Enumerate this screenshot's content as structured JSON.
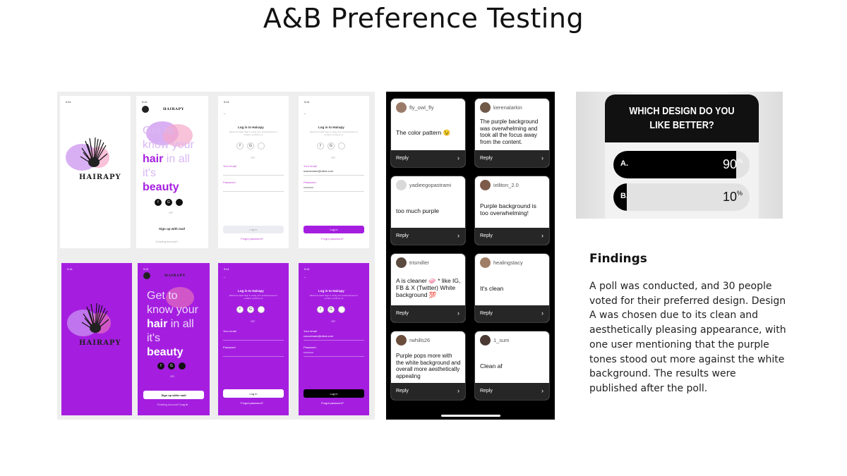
{
  "title": "A&B Preference Testing",
  "mockups": {
    "status_time": "9:41",
    "brand": "HAIRAPY",
    "tagline_parts": [
      "Get to",
      "know your",
      "hair",
      "in all",
      "it's",
      "beauty"
    ],
    "signup_label": "Sign up with mail",
    "signup_label_purple": "Sign up withe mail",
    "existing_account": "Existing account?",
    "login_link": "Log In",
    "login_title": "Log in to Hairapy",
    "login_subtitle": "Welcome back! Sign in using your social account or email to continue us",
    "or_label": "OR",
    "email_label": "Your email",
    "email_value": "nazozimam@uthut.com",
    "password_label": "Password",
    "password_value": "••••••••••",
    "login_button": "Log in",
    "forgot_password": "Forgot password?"
  },
  "replies": [
    {
      "user": "fly_owl_fly",
      "text": "The color pattern 😉",
      "reply": "Reply",
      "avatar": "#9a7b6a"
    },
    {
      "user": "kerenalarkin",
      "text": "The purple background was overwhelming and took all the focus away from the content.",
      "reply": "Reply",
      "avatar": "#6f5a4a"
    },
    {
      "user": "yadieegopastrami",
      "text": "too much purple",
      "reply": "Reply",
      "avatar": "#d9d9d9"
    },
    {
      "user": "ixtliton_2.0",
      "text": "Purple background is too overwhelming!",
      "reply": "Reply",
      "avatar": "#7d5a49"
    },
    {
      "user": "trismiller",
      "text": "A is cleaner 🧼 * like IG, FB & X (Twitter) White background 💯",
      "reply": "Reply",
      "avatar": "#5b4a3f"
    },
    {
      "user": "healingstacy",
      "text": "It's clean",
      "reply": "Reply",
      "avatar": "#a07d66"
    },
    {
      "user": "rwhills26",
      "text": "Purple pops more with the white background and overall more aesthetically appealing",
      "reply": "Reply",
      "avatar": "#6b4d3c"
    },
    {
      "user": "1_sum",
      "text": "Clean af",
      "reply": "Reply",
      "avatar": "#4a3a33"
    }
  ],
  "poll": {
    "question": "WHICH DESIGN DO YOU LIKE BETTER?",
    "options": [
      {
        "label": "A.",
        "percent": 90
      },
      {
        "label": "B.",
        "percent": 10
      }
    ],
    "percent_sign": "%"
  },
  "findings": {
    "heading": "Findings",
    "body": "A poll was conducted, and 30 people voted for their preferred design. Design A was chosen due to its clean and aesthetically pleasing appearance, with one user mentioning that the purple tones stood out more against the white background. The results were published after the poll."
  },
  "colors": {
    "accent_purple": "#a51ee0",
    "poll_dark": "#111111"
  }
}
